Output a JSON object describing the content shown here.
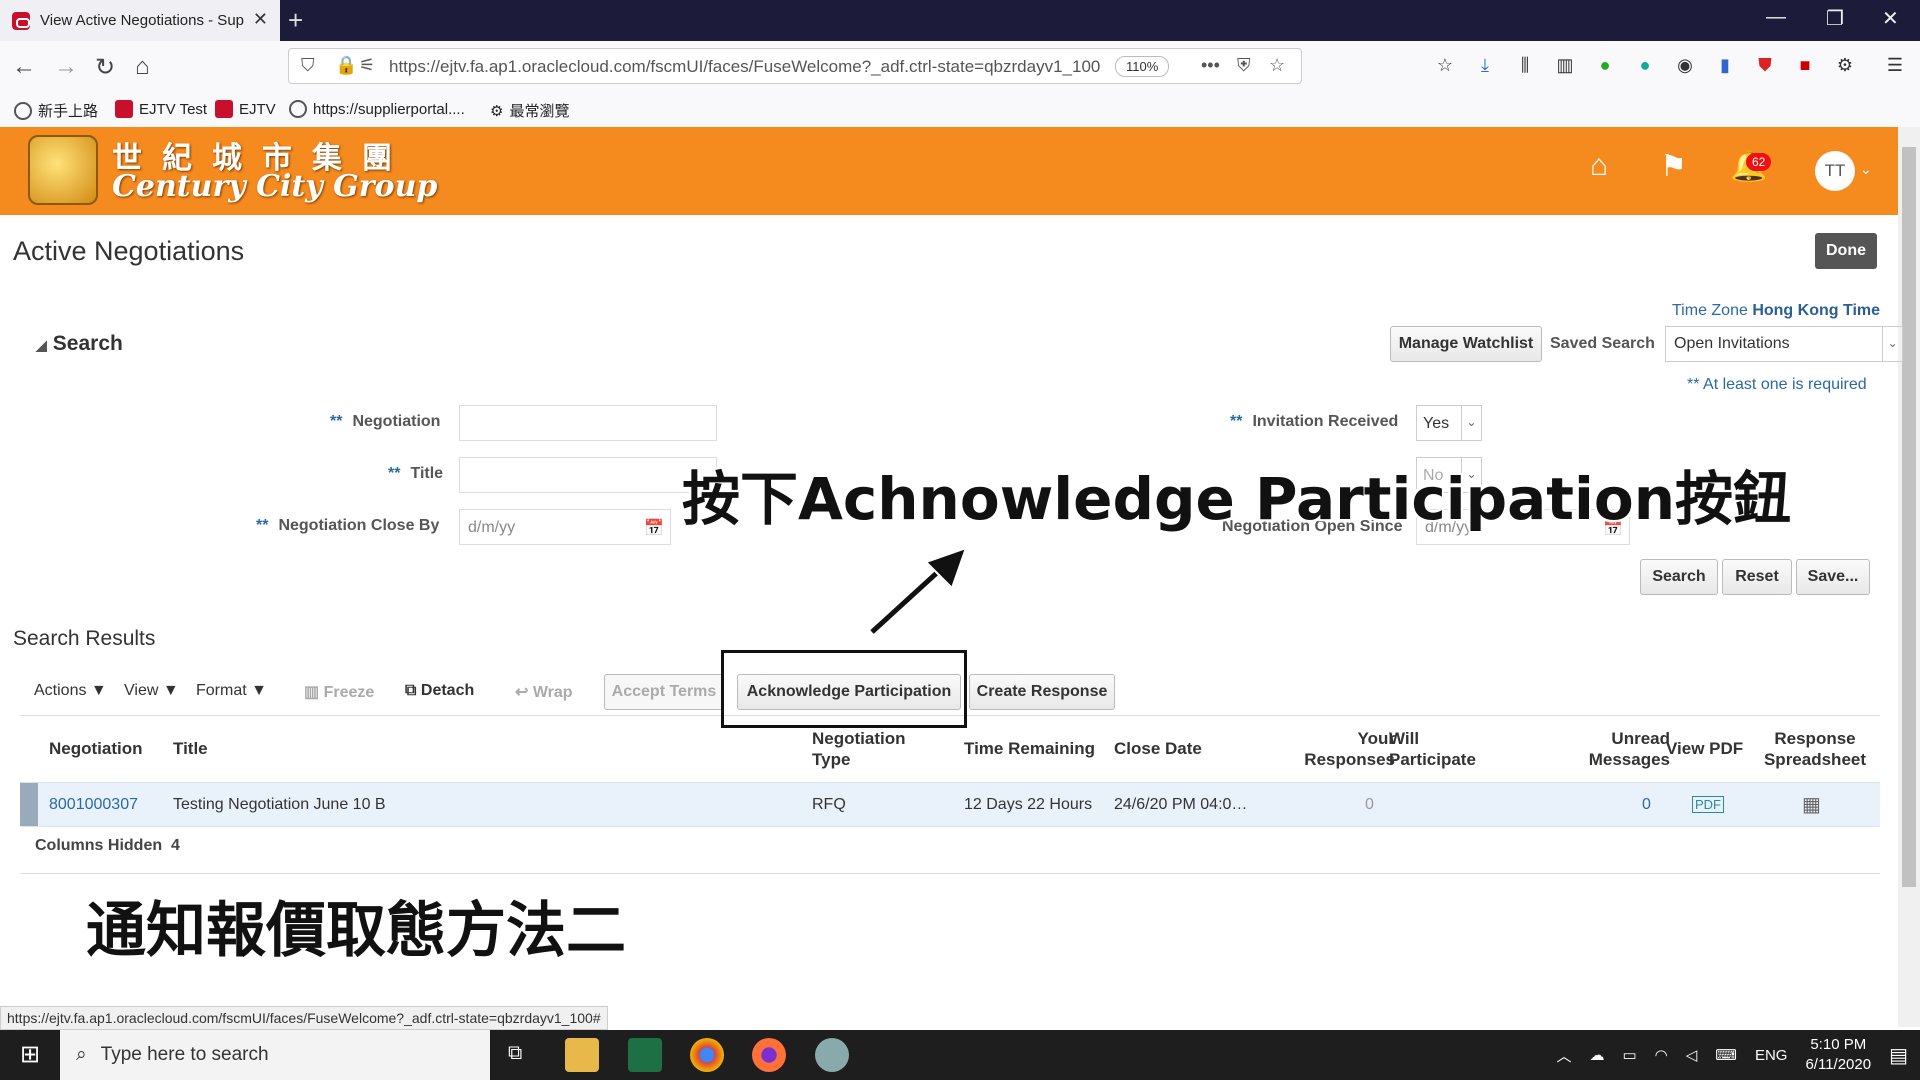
{
  "browser": {
    "tab_title": "View Active Negotiations - Sup",
    "url": "https://ejtv.fa.ap1.oraclecloud.com/fscmUI/faces/FuseWelcome?_adf.ctrl-state=qbzrdayv1_100",
    "zoom": "110%",
    "bookmarks": [
      "新手上路",
      "EJTV Test",
      "EJTV",
      "https://supplierportal....",
      "最常瀏覽"
    ]
  },
  "header": {
    "logo_cn": "世紀城市集團",
    "logo_en": "Century City Group",
    "notification_count": "62",
    "avatar_initials": "TT"
  },
  "page": {
    "title": "Active Negotiations",
    "done_label": "Done",
    "timezone_prefix": "Time Zone",
    "timezone_value": "Hong Kong Time"
  },
  "search": {
    "header": "Search",
    "manage_watchlist": "Manage Watchlist",
    "saved_search_label": "Saved Search",
    "saved_search_value": "Open Invitations",
    "required_note": "** At least one is required",
    "required_marker": "**",
    "fields": {
      "negotiation_label": "Negotiation",
      "title_label": "Title",
      "close_by_label": "Negotiation Close By",
      "close_by_placeholder": "d/m/yy",
      "invitation_label": "Invitation Received",
      "invitation_value": "Yes",
      "open_since_label": "Negotiation Open Since",
      "open_since_placeholder": "d/m/yy",
      "response_value": "No"
    },
    "buttons": {
      "search": "Search",
      "reset": "Reset",
      "save": "Save..."
    }
  },
  "results": {
    "title": "Search Results",
    "toolbar": {
      "actions": "Actions",
      "view": "View",
      "format": "Format",
      "freeze": "Freeze",
      "detach": "Detach",
      "wrap": "Wrap",
      "accept_terms": "Accept Terms",
      "acknowledge": "Acknowledge Participation",
      "create_response": "Create Response"
    },
    "columns": {
      "negotiation": "Negotiation",
      "title": "Title",
      "type_1": "Negotiation",
      "type_2": "Type",
      "time_remaining": "Time Remaining",
      "close_date": "Close Date",
      "your_1": "Your",
      "your_2": "Responses",
      "will_1": "Will",
      "will_2": "Participate",
      "unread_1": "Unread",
      "unread_2": "Messages",
      "view_pdf": "View PDF",
      "resp_1": "Response",
      "resp_2": "Spreadsheet"
    },
    "row": {
      "negotiation": "8001000307",
      "title": "Testing Negotiation June 10 B",
      "type": "RFQ",
      "time_remaining": "12 Days 22 Hours",
      "close_date": "24/6/20 PM 04:0…",
      "your_responses": "0",
      "unread_messages": "0"
    },
    "columns_hidden_label": "Columns Hidden",
    "columns_hidden_count": "4"
  },
  "annotations": {
    "instruction": "按下Achnowledge Participation按鈕",
    "caption": "通知報價取態方法二"
  },
  "status_url": "https://ejtv.fa.ap1.oraclecloud.com/fscmUI/faces/FuseWelcome?_adf.ctrl-state=qbzrdayv1_100#",
  "taskbar": {
    "search_placeholder": "Type here to search",
    "language": "ENG",
    "time": "5:10 PM",
    "date": "6/11/2020"
  }
}
